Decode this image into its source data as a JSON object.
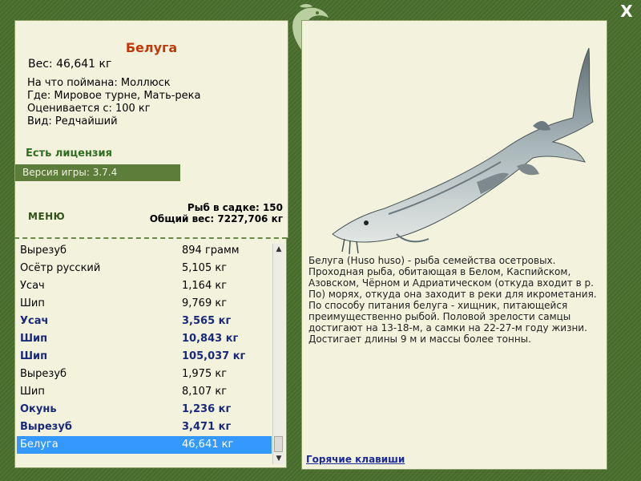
{
  "window": {
    "close_label": "X"
  },
  "fish": {
    "name": "Белуга",
    "weight": "Вес: 46,641 кг",
    "caught_on": "На что поймана: Моллюск",
    "location": "Где: Мировое турне, Мать-река",
    "valued_from": "Оценивается с: 100 кг",
    "rarity": "Вид: Редчайший",
    "description": "Белуга (Huso huso) - рыба семейства осетровых. Проходная рыба, обитающая в Белом, Каспийском, Азовском, Чёрном и Адриатическом (откуда входит в р. По) морях, откуда она заходит в реки для икрометания. По способу питания белуга - хищник, питающейся преимущественно рыбой. Половой зрелости самцы достигают на 13-18-м, а самки на 22-27-м году жизни. Достигает длины 9 м и массы более тонны."
  },
  "license": "Есть лицензия",
  "version": "Версия игры: 3.7.4",
  "menu_label": "МЕНЮ",
  "stats": {
    "fish_count": "Рыб в садке: 150",
    "total_weight": "Общий вес: 7227,706 кг"
  },
  "catch_list": [
    {
      "name": "Вырезуб",
      "weight": "894 грамм",
      "bold": false
    },
    {
      "name": "Осётр русский",
      "weight": "5,105 кг",
      "bold": false
    },
    {
      "name": "Усач",
      "weight": "1,164 кг",
      "bold": false
    },
    {
      "name": "Шип",
      "weight": "9,769 кг",
      "bold": false
    },
    {
      "name": "Усач",
      "weight": "3,565 кг",
      "bold": true
    },
    {
      "name": "Шип",
      "weight": "10,843 кг",
      "bold": true
    },
    {
      "name": "Шип",
      "weight": "105,037 кг",
      "bold": true
    },
    {
      "name": "Вырезуб",
      "weight": "1,975 кг",
      "bold": false
    },
    {
      "name": "Шип",
      "weight": "8,107 кг",
      "bold": false
    },
    {
      "name": "Окунь",
      "weight": "1,236 кг",
      "bold": true
    },
    {
      "name": "Вырезуб",
      "weight": "3,471 кг",
      "bold": true
    },
    {
      "name": "Белуга",
      "weight": "46,641 кг",
      "bold": false,
      "selected": true
    }
  ],
  "hotkeys_label": "Горячие клавиши",
  "colors": {
    "frame": "#4f7433",
    "panel": "#f3f2dd",
    "title": "#c0390a",
    "license": "#2f6f1f",
    "selection": "#3399ff",
    "link": "#1a2a9a"
  }
}
